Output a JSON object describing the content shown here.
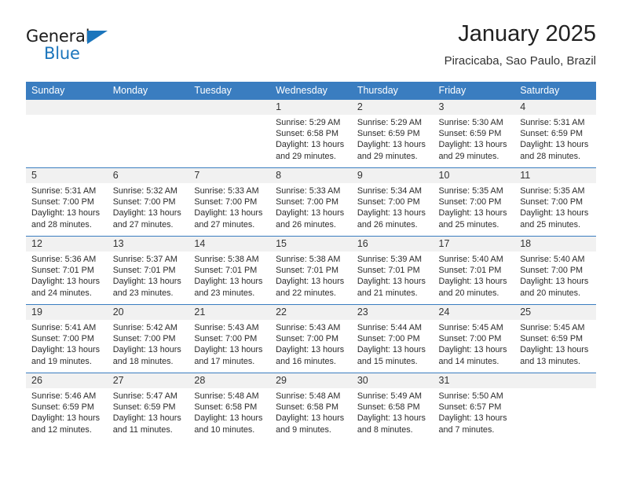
{
  "brand": {
    "name_part1": "General",
    "name_part2": "Blue",
    "logo_icon": "triangle-flag-icon"
  },
  "header": {
    "title": "January 2025",
    "subtitle": "Piracicaba, Sao Paulo, Brazil"
  },
  "colors": {
    "header_blue": "#3a7dc0",
    "brand_blue": "#1b75bc",
    "daynum_band": "#f1f1f1",
    "text": "#2b2b2b"
  },
  "calendar": {
    "weekday_headers": [
      "Sunday",
      "Monday",
      "Tuesday",
      "Wednesday",
      "Thursday",
      "Friday",
      "Saturday"
    ],
    "labels": {
      "sunrise": "Sunrise:",
      "sunset": "Sunset:",
      "daylight": "Daylight:"
    },
    "weeks": [
      [
        {
          "day": "",
          "blank": true
        },
        {
          "day": "",
          "blank": true
        },
        {
          "day": "",
          "blank": true
        },
        {
          "day": "1",
          "sunrise": "Sunrise: 5:29 AM",
          "sunset": "Sunset: 6:58 PM",
          "daylight1": "Daylight: 13 hours",
          "daylight2": "and 29 minutes."
        },
        {
          "day": "2",
          "sunrise": "Sunrise: 5:29 AM",
          "sunset": "Sunset: 6:59 PM",
          "daylight1": "Daylight: 13 hours",
          "daylight2": "and 29 minutes."
        },
        {
          "day": "3",
          "sunrise": "Sunrise: 5:30 AM",
          "sunset": "Sunset: 6:59 PM",
          "daylight1": "Daylight: 13 hours",
          "daylight2": "and 29 minutes."
        },
        {
          "day": "4",
          "sunrise": "Sunrise: 5:31 AM",
          "sunset": "Sunset: 6:59 PM",
          "daylight1": "Daylight: 13 hours",
          "daylight2": "and 28 minutes."
        }
      ],
      [
        {
          "day": "5",
          "sunrise": "Sunrise: 5:31 AM",
          "sunset": "Sunset: 7:00 PM",
          "daylight1": "Daylight: 13 hours",
          "daylight2": "and 28 minutes."
        },
        {
          "day": "6",
          "sunrise": "Sunrise: 5:32 AM",
          "sunset": "Sunset: 7:00 PM",
          "daylight1": "Daylight: 13 hours",
          "daylight2": "and 27 minutes."
        },
        {
          "day": "7",
          "sunrise": "Sunrise: 5:33 AM",
          "sunset": "Sunset: 7:00 PM",
          "daylight1": "Daylight: 13 hours",
          "daylight2": "and 27 minutes."
        },
        {
          "day": "8",
          "sunrise": "Sunrise: 5:33 AM",
          "sunset": "Sunset: 7:00 PM",
          "daylight1": "Daylight: 13 hours",
          "daylight2": "and 26 minutes."
        },
        {
          "day": "9",
          "sunrise": "Sunrise: 5:34 AM",
          "sunset": "Sunset: 7:00 PM",
          "daylight1": "Daylight: 13 hours",
          "daylight2": "and 26 minutes."
        },
        {
          "day": "10",
          "sunrise": "Sunrise: 5:35 AM",
          "sunset": "Sunset: 7:00 PM",
          "daylight1": "Daylight: 13 hours",
          "daylight2": "and 25 minutes."
        },
        {
          "day": "11",
          "sunrise": "Sunrise: 5:35 AM",
          "sunset": "Sunset: 7:00 PM",
          "daylight1": "Daylight: 13 hours",
          "daylight2": "and 25 minutes."
        }
      ],
      [
        {
          "day": "12",
          "sunrise": "Sunrise: 5:36 AM",
          "sunset": "Sunset: 7:01 PM",
          "daylight1": "Daylight: 13 hours",
          "daylight2": "and 24 minutes."
        },
        {
          "day": "13",
          "sunrise": "Sunrise: 5:37 AM",
          "sunset": "Sunset: 7:01 PM",
          "daylight1": "Daylight: 13 hours",
          "daylight2": "and 23 minutes."
        },
        {
          "day": "14",
          "sunrise": "Sunrise: 5:38 AM",
          "sunset": "Sunset: 7:01 PM",
          "daylight1": "Daylight: 13 hours",
          "daylight2": "and 23 minutes."
        },
        {
          "day": "15",
          "sunrise": "Sunrise: 5:38 AM",
          "sunset": "Sunset: 7:01 PM",
          "daylight1": "Daylight: 13 hours",
          "daylight2": "and 22 minutes."
        },
        {
          "day": "16",
          "sunrise": "Sunrise: 5:39 AM",
          "sunset": "Sunset: 7:01 PM",
          "daylight1": "Daylight: 13 hours",
          "daylight2": "and 21 minutes."
        },
        {
          "day": "17",
          "sunrise": "Sunrise: 5:40 AM",
          "sunset": "Sunset: 7:01 PM",
          "daylight1": "Daylight: 13 hours",
          "daylight2": "and 20 minutes."
        },
        {
          "day": "18",
          "sunrise": "Sunrise: 5:40 AM",
          "sunset": "Sunset: 7:00 PM",
          "daylight1": "Daylight: 13 hours",
          "daylight2": "and 20 minutes."
        }
      ],
      [
        {
          "day": "19",
          "sunrise": "Sunrise: 5:41 AM",
          "sunset": "Sunset: 7:00 PM",
          "daylight1": "Daylight: 13 hours",
          "daylight2": "and 19 minutes."
        },
        {
          "day": "20",
          "sunrise": "Sunrise: 5:42 AM",
          "sunset": "Sunset: 7:00 PM",
          "daylight1": "Daylight: 13 hours",
          "daylight2": "and 18 minutes."
        },
        {
          "day": "21",
          "sunrise": "Sunrise: 5:43 AM",
          "sunset": "Sunset: 7:00 PM",
          "daylight1": "Daylight: 13 hours",
          "daylight2": "and 17 minutes."
        },
        {
          "day": "22",
          "sunrise": "Sunrise: 5:43 AM",
          "sunset": "Sunset: 7:00 PM",
          "daylight1": "Daylight: 13 hours",
          "daylight2": "and 16 minutes."
        },
        {
          "day": "23",
          "sunrise": "Sunrise: 5:44 AM",
          "sunset": "Sunset: 7:00 PM",
          "daylight1": "Daylight: 13 hours",
          "daylight2": "and 15 minutes."
        },
        {
          "day": "24",
          "sunrise": "Sunrise: 5:45 AM",
          "sunset": "Sunset: 7:00 PM",
          "daylight1": "Daylight: 13 hours",
          "daylight2": "and 14 minutes."
        },
        {
          "day": "25",
          "sunrise": "Sunrise: 5:45 AM",
          "sunset": "Sunset: 6:59 PM",
          "daylight1": "Daylight: 13 hours",
          "daylight2": "and 13 minutes."
        }
      ],
      [
        {
          "day": "26",
          "sunrise": "Sunrise: 5:46 AM",
          "sunset": "Sunset: 6:59 PM",
          "daylight1": "Daylight: 13 hours",
          "daylight2": "and 12 minutes."
        },
        {
          "day": "27",
          "sunrise": "Sunrise: 5:47 AM",
          "sunset": "Sunset: 6:59 PM",
          "daylight1": "Daylight: 13 hours",
          "daylight2": "and 11 minutes."
        },
        {
          "day": "28",
          "sunrise": "Sunrise: 5:48 AM",
          "sunset": "Sunset: 6:58 PM",
          "daylight1": "Daylight: 13 hours",
          "daylight2": "and 10 minutes."
        },
        {
          "day": "29",
          "sunrise": "Sunrise: 5:48 AM",
          "sunset": "Sunset: 6:58 PM",
          "daylight1": "Daylight: 13 hours",
          "daylight2": "and 9 minutes."
        },
        {
          "day": "30",
          "sunrise": "Sunrise: 5:49 AM",
          "sunset": "Sunset: 6:58 PM",
          "daylight1": "Daylight: 13 hours",
          "daylight2": "and 8 minutes."
        },
        {
          "day": "31",
          "sunrise": "Sunrise: 5:50 AM",
          "sunset": "Sunset: 6:57 PM",
          "daylight1": "Daylight: 13 hours",
          "daylight2": "and 7 minutes."
        },
        {
          "day": "",
          "blank": true
        }
      ]
    ]
  }
}
